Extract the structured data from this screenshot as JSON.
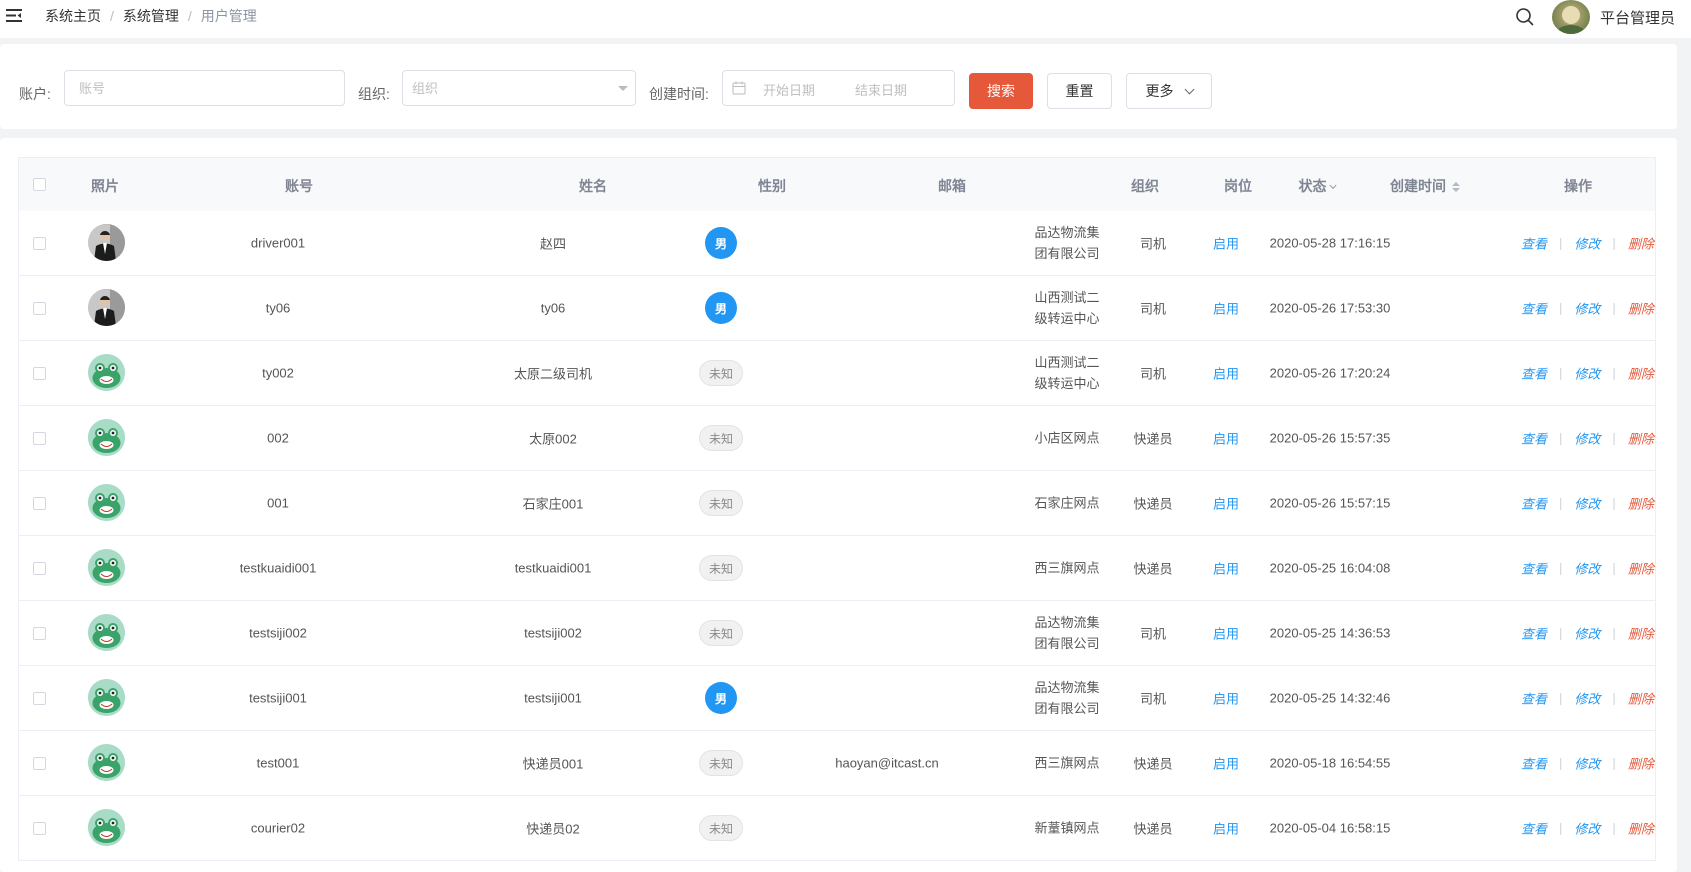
{
  "header": {
    "menu_icon": "menu-fold-icon",
    "breadcrumb": [
      "系统主页",
      "系统管理",
      "用户管理"
    ],
    "breadcrumb_sep": "/",
    "search_icon": "search-icon",
    "user_name": "平台管理员"
  },
  "filter": {
    "account_label": "账户:",
    "account_placeholder": "账号",
    "org_label": "组织:",
    "org_placeholder": "组织",
    "created_label": "创建时间:",
    "start_placeholder": "开始日期",
    "end_placeholder": "结束日期",
    "search_button": "搜索",
    "reset_button": "重置",
    "more_button": "更多"
  },
  "table": {
    "columns": {
      "photo": "照片",
      "account": "账号",
      "name": "姓名",
      "gender": "性别",
      "email": "邮箱",
      "org": "组织",
      "post": "岗位",
      "status": "状态",
      "created": "创建时间",
      "actions": "操作"
    },
    "action_labels": {
      "view": "查看",
      "edit": "修改",
      "delete": "删除",
      "sep": "|"
    },
    "rows": [
      {
        "photo": "person",
        "account": "driver001",
        "name": "赵四",
        "gender": "男",
        "gender_type": "male",
        "email": "",
        "org": "品达物流集团有限公司",
        "post": "司机",
        "status": "启用",
        "created": "2020-05-28 17:16:15"
      },
      {
        "photo": "person",
        "account": "ty06",
        "name": "ty06",
        "gender": "男",
        "gender_type": "male",
        "email": "",
        "org": "山西测试二级转运中心",
        "post": "司机",
        "status": "启用",
        "created": "2020-05-26 17:53:30"
      },
      {
        "photo": "frog",
        "account": "ty002",
        "name": "太原二级司机",
        "gender": "未知",
        "gender_type": "unknown",
        "email": "",
        "org": "山西测试二级转运中心",
        "post": "司机",
        "status": "启用",
        "created": "2020-05-26 17:20:24"
      },
      {
        "photo": "frog",
        "account": "002",
        "name": "太原002",
        "gender": "未知",
        "gender_type": "unknown",
        "email": "",
        "org": "小店区网点",
        "post": "快递员",
        "status": "启用",
        "created": "2020-05-26 15:57:35"
      },
      {
        "photo": "frog",
        "account": "001",
        "name": "石家庄001",
        "gender": "未知",
        "gender_type": "unknown",
        "email": "",
        "org": "石家庄网点",
        "post": "快递员",
        "status": "启用",
        "created": "2020-05-26 15:57:15"
      },
      {
        "photo": "frog",
        "account": "testkuaidi001",
        "name": "testkuaidi001",
        "gender": "未知",
        "gender_type": "unknown",
        "email": "",
        "org": "西三旗网点",
        "post": "快递员",
        "status": "启用",
        "created": "2020-05-25 16:04:08"
      },
      {
        "photo": "frog",
        "account": "testsiji002",
        "name": "testsiji002",
        "gender": "未知",
        "gender_type": "unknown",
        "email": "",
        "org": "品达物流集团有限公司",
        "post": "司机",
        "status": "启用",
        "created": "2020-05-25 14:36:53"
      },
      {
        "photo": "frog",
        "account": "testsiji001",
        "name": "testsiji001",
        "gender": "男",
        "gender_type": "male",
        "email": "",
        "org": "品达物流集团有限公司",
        "post": "司机",
        "status": "启用",
        "created": "2020-05-25 14:32:46"
      },
      {
        "photo": "frog",
        "account": "test001",
        "name": "快递员001",
        "gender": "未知",
        "gender_type": "unknown",
        "email": "haoyan@itcast.cn",
        "org": "西三旗网点",
        "post": "快递员",
        "status": "启用",
        "created": "2020-05-18 16:54:55"
      },
      {
        "photo": "frog",
        "account": "courier02",
        "name": "快递员02",
        "gender": "未知",
        "gender_type": "unknown",
        "email": "",
        "org": "新蕫镇网点",
        "post": "快递员",
        "status": "启用",
        "created": "2020-05-04 16:58:15"
      }
    ]
  }
}
